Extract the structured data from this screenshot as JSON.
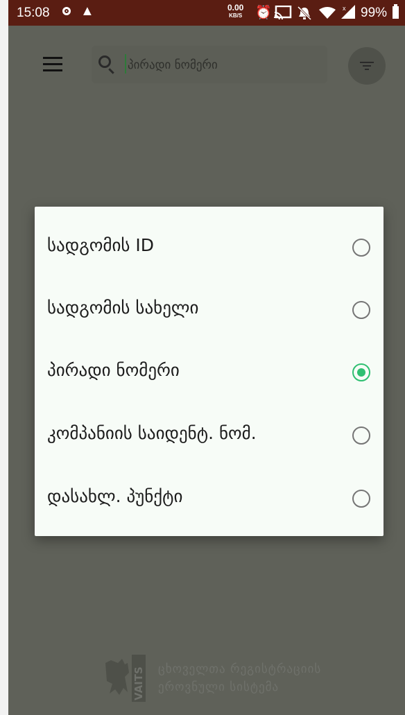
{
  "status_bar": {
    "time": "15:08",
    "net_speed_value": "0.00",
    "net_speed_unit": "KB/S",
    "battery_percent": "99%",
    "icons": [
      "record-icon",
      "warning-icon",
      "alarm-icon",
      "cast-icon",
      "notifications-off-icon",
      "wifi-icon",
      "signal-icon",
      "battery-icon"
    ]
  },
  "toolbar": {
    "menu_icon": "menu-icon",
    "search": {
      "placeholder": "პირადი ნომერი",
      "value": "",
      "icon": "search-icon"
    },
    "filter_icon": "filter-icon"
  },
  "dialog": {
    "options": [
      {
        "label": "სადგომის ID",
        "selected": false
      },
      {
        "label": "სადგომის სახელი",
        "selected": false
      },
      {
        "label": "პირადი ნომერი",
        "selected": true
      },
      {
        "label": "კომპანიის საიდენტ. ნომ.",
        "selected": false
      },
      {
        "label": "დასახლ. პუნქტი",
        "selected": false
      }
    ]
  },
  "footer_logo": {
    "mark_text": "VAITS",
    "line1": "ცხოველთა რეგისტრაციის",
    "line2": "ეროვნული სისტემა"
  },
  "colors": {
    "status_bar": "#5a1d12",
    "scrim_background": "#5f6159",
    "dialog_background": "#f7fcf7",
    "radio_selected": "#2fbf71",
    "radio_unselected": "#757575"
  }
}
